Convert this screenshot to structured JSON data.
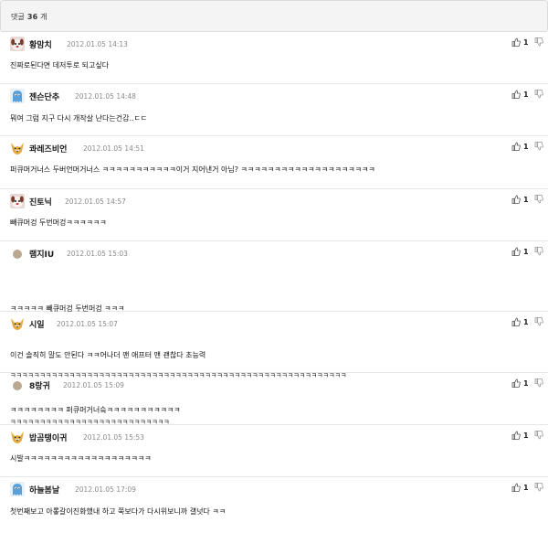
{
  "header": {
    "label": "댓글",
    "count": "36",
    "unit": "개"
  },
  "comments": [
    {
      "nick": "황맘치",
      "date": "2012.01.05 14:13",
      "avatar": "dog-icon",
      "likes": "1",
      "lines": [
        "진짜로된다면 데저투로 되고싶다"
      ]
    },
    {
      "nick": "젠슨단추",
      "date": "2012.01.05 14:48",
      "avatar": "blue-ghost-icon",
      "likes": "1",
      "lines": [
        "뭐여 그럼 지구 다시 개작살 난다는건감..ㄷㄷ"
      ]
    },
    {
      "nick": "콰레즈비언",
      "date": "2012.01.05 14:51",
      "avatar": "fox-icon",
      "likes": "1",
      "lines": [
        "퍼큐머거너스 두버언머거너스 ㅋㅋㅋㅋㅋㅋㅋㅋㅋㅋㅋ이거 지어낸거 아님? ㅋㅋㅋㅋㅋㅋㅋㅋㅋㅋㅋㅋㅋㅋㅋㅋㅋㅋㅋㅋ"
      ]
    },
    {
      "nick": "진토닉",
      "date": "2012.01.05 14:57",
      "avatar": "dog-icon",
      "likes": "1",
      "lines": [
        "빼큐머겅 두번머겅ㅋㅋㅋㅋㅋㅋ"
      ]
    },
    {
      "nick": "램지IU",
      "date": "2012.01.05 15:03",
      "avatar": "circle-avatar-icon",
      "likes": "1",
      "lines": [
        "ㅋㅋㅋㅋㅋ 빼큐머겅 두번머겅 ㅋㅋㅋ",
        "이건 솔직히 말도 안된다 ㅋㅋ어나더 맨 애프터 맨 괜찮다 초능력"
      ]
    },
    {
      "nick": "시일",
      "date": "2012.01.05 15:07",
      "avatar": "fox-icon",
      "likes": "1",
      "lines": [
        "ㅋㅋㅋㅋㅋㅋㅋㅋㅋㅋㅋㅋㅋㅋㅋㅋㅋㅋㅋㅋㅋㅋㅋㅋㅋㅋㅋㅋㅋㅋㅋㅋㅋㅋㅋㅋㅋㅋㅋㅋㅋㅋㅋㅋㅋㅋㅋㅋㅋㅋㅋㅋㅋㅋㅋㅋㅋ",
        "ㅋㅋㅋㅋㅋㅋㅋㅋㅋㅋㅋㅋㅋㅋㅋㅋㅋㅋㅋㅋㅋㅋㅋㅋㅋㅋㅋ"
      ]
    },
    {
      "nick": "8랑귀",
      "date": "2012.01.05 15:09",
      "avatar": "circle-avatar-icon",
      "likes": "1",
      "lines": [
        "ㅋㅋㅋㅋㅋㅋㅋㅋ 퍼큐머거너슼ㅋㅋㅋㅋㅋㅋㅋㅋㅋㅋㅋ"
      ]
    },
    {
      "nick": "밥곰탱이귀",
      "date": "2012.01.05 15:53",
      "avatar": "fox-icon",
      "likes": "1",
      "lines": [
        "시발ㅋㅋㅋㅋㅋㅋㅋㅋㅋㅋㅋㅋㅋㅋㅋㅋㅋㅋㅋ"
      ]
    },
    {
      "nick": "하늘봄날",
      "date": "2012.01.05 17:09",
      "avatar": "blue-ghost-icon",
      "likes": "1",
      "lines": [
        "첫번째보고 아롷갈이진화했내 하고 쭉보다가 다시위보니까 걜넛다 ㅋㅋ"
      ]
    }
  ]
}
